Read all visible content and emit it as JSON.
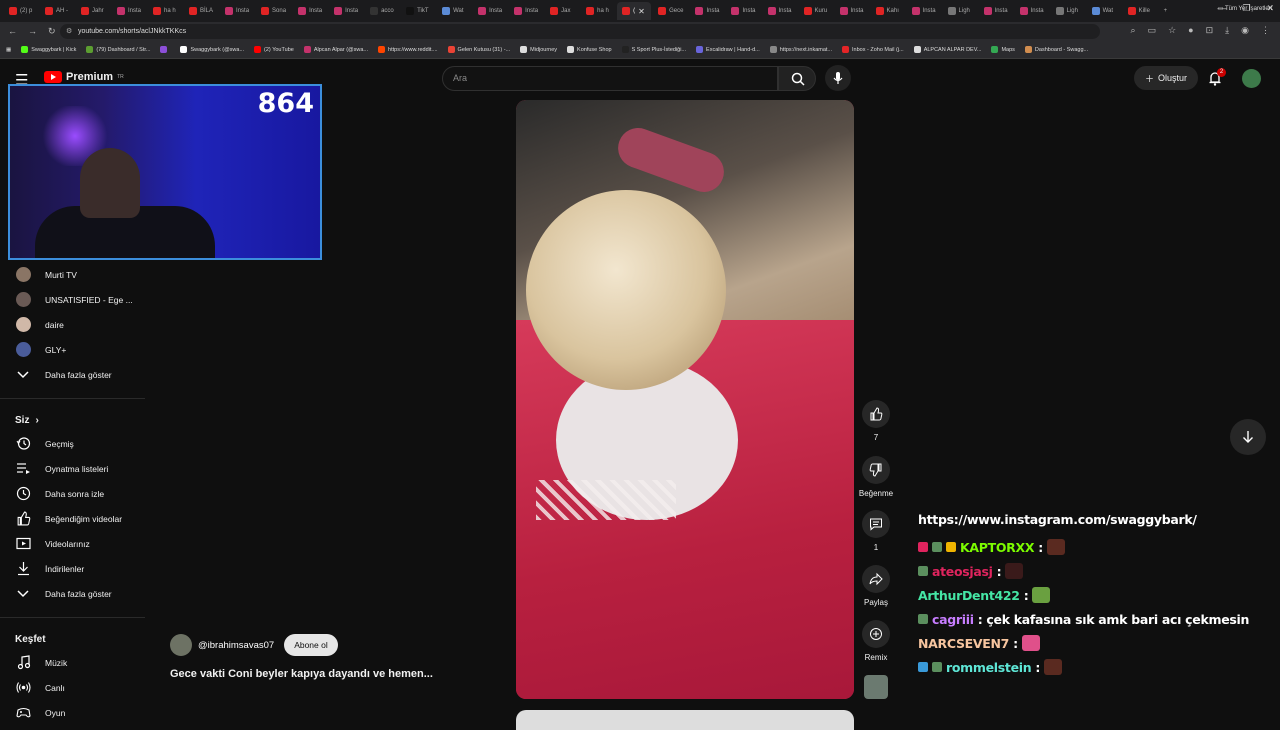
{
  "browser": {
    "tabs": [
      {
        "label": "(2) p",
        "color": "#e02424"
      },
      {
        "label": "AH -",
        "color": "#e02424"
      },
      {
        "label": "Jahr",
        "color": "#e02424"
      },
      {
        "label": "Insta",
        "color": "#c4326b"
      },
      {
        "label": "ha h",
        "color": "#e02424"
      },
      {
        "label": "BİLA",
        "color": "#e02424"
      },
      {
        "label": "Insta",
        "color": "#c4326b"
      },
      {
        "label": "Sona",
        "color": "#e02424"
      },
      {
        "label": "Insta",
        "color": "#c4326b"
      },
      {
        "label": "Insta",
        "color": "#c4326b"
      },
      {
        "label": "acco",
        "color": "#333333"
      },
      {
        "label": "TikT",
        "color": "#111111"
      },
      {
        "label": "Wat",
        "color": "#5b8bd6"
      },
      {
        "label": "Insta",
        "color": "#c4326b"
      },
      {
        "label": "Insta",
        "color": "#c4326b"
      },
      {
        "label": "Jax",
        "color": "#e02424"
      },
      {
        "label": "ha h",
        "color": "#e02424"
      },
      {
        "label": "(",
        "color": "#e02424"
      },
      {
        "label": "Gece",
        "color": "#e02424"
      },
      {
        "label": "Insta",
        "color": "#c4326b"
      },
      {
        "label": "Insta",
        "color": "#c4326b"
      },
      {
        "label": "Insta",
        "color": "#c4326b"
      },
      {
        "label": "Kuru",
        "color": "#e02424"
      },
      {
        "label": "Insta",
        "color": "#c4326b"
      },
      {
        "label": "Kahı",
        "color": "#e02424"
      },
      {
        "label": "Insta",
        "color": "#c4326b"
      },
      {
        "label": "Ligh",
        "color": "#777777"
      },
      {
        "label": "Insta",
        "color": "#c4326b"
      },
      {
        "label": "Insta",
        "color": "#c4326b"
      },
      {
        "label": "Ligh",
        "color": "#777777"
      },
      {
        "label": "Wat",
        "color": "#5b8bd6"
      },
      {
        "label": "Kille",
        "color": "#e02424"
      }
    ],
    "active_tab_index": 17,
    "new_tab": "+",
    "url": "youtube.com/shorts/aclJNkkTKKcs",
    "bookmarks": [
      {
        "label": "Swaggybark | Kick",
        "color": "#53fc18"
      },
      {
        "label": "(79) Dashboard / Str...",
        "color": "#5c9e31"
      },
      {
        "label": "",
        "color": "#8c4fd8"
      },
      {
        "label": "Swaggybark (@swa...",
        "color": "#ffffff"
      },
      {
        "label": "(2) YouTube",
        "color": "#ff0000"
      },
      {
        "label": "Alpcan Alpar (@swa...",
        "color": "#c4326b"
      },
      {
        "label": "https://www.reddit....",
        "color": "#ff4500"
      },
      {
        "label": "Gelen Kutusu (31) -...",
        "color": "#ea4335"
      },
      {
        "label": "Midjourney",
        "color": "#dddddd"
      },
      {
        "label": "Konfuse Shop",
        "color": "#dddddd"
      },
      {
        "label": "S Sport Plus-İstediği...",
        "color": "#222222"
      },
      {
        "label": "Excalidraw | Hand-d...",
        "color": "#6965db"
      },
      {
        "label": "https://next.inkamat...",
        "color": "#888888"
      },
      {
        "label": "Inbox - Zoho Mail (j...",
        "color": "#e42527"
      },
      {
        "label": "ALPCAN ALPAR DEV...",
        "color": "#dddddd"
      },
      {
        "label": "Maps",
        "color": "#34a853"
      },
      {
        "label": "Dashboard - Swagg...",
        "color": "#d18d4f"
      }
    ],
    "bookmarks_right": "Tüm Yer İşaretleri"
  },
  "youtube": {
    "logo_text": "Premium",
    "logo_region": "TR",
    "search_placeholder": "Ara",
    "create_label": "Oluştur",
    "notifications_count": "2"
  },
  "webcam": {
    "counter": "864"
  },
  "sidebar": {
    "subscriptions": [
      {
        "label": "Murti TV",
        "color": "#8a7565"
      },
      {
        "label": "UNSATISFIED - Ege ...",
        "color": "#6a5a55"
      },
      {
        "label": "daire",
        "color": "#d0b8a8"
      },
      {
        "label": "GLY+",
        "color": "#4a5c9a"
      }
    ],
    "show_more_1": "Daha fazla göster",
    "you_header": "Siz",
    "you_items": [
      {
        "label": "Geçmiş",
        "icon": "history-icon"
      },
      {
        "label": "Oynatma listeleri",
        "icon": "playlists-icon"
      },
      {
        "label": "Daha sonra izle",
        "icon": "watch-later-icon"
      },
      {
        "label": "Beğendiğim videolar",
        "icon": "liked-icon"
      },
      {
        "label": "Videolarınız",
        "icon": "your-videos-icon"
      },
      {
        "label": "İndirilenler",
        "icon": "downloads-icon"
      }
    ],
    "show_more_2": "Daha fazla göster",
    "explore_header": "Keşfet",
    "explore_items": [
      {
        "label": "Müzik",
        "icon": "music-icon"
      },
      {
        "label": "Canlı",
        "icon": "live-icon"
      },
      {
        "label": "Oyun",
        "icon": "gaming-icon"
      }
    ]
  },
  "short": {
    "handle": "@ibrahimsavas07",
    "subscribe_label": "Abone ol",
    "title": "Gece vakti Coni beyler kapıya dayandı ve hemen...",
    "like_count": "7",
    "dislike_label": "Beğenme",
    "comment_count": "1",
    "share_label": "Paylaş",
    "remix_label": "Remix"
  },
  "chat": {
    "link": "https://www.instagram.com/swaggybark/",
    "messages": [
      {
        "user": "KAPTORXX",
        "color": "#7cfc00",
        "text": "",
        "badges": [
          "#e0245e",
          "#5b8f5e",
          "#f0b400"
        ],
        "emote": "#5a2a20"
      },
      {
        "user": "ateosjasj",
        "color": "#e0245e",
        "text": "",
        "badges": [
          "#5b8f5e"
        ],
        "emote": "#3a1a1a"
      },
      {
        "user": "ArthurDent422",
        "color": "#45e6a5",
        "text": "",
        "badges": [],
        "emote": "#6aa040"
      },
      {
        "user": "cagriii",
        "color": "#c77dff",
        "text": "çek kafasına sık amk bari acı çekmesin",
        "badges": [
          "#5b8f5e"
        ],
        "emote": ""
      },
      {
        "user": "NARCSEVEN7",
        "color": "#f7c59f",
        "text": "",
        "badges": [],
        "emote": "#e0508a"
      },
      {
        "user": "rommelstein",
        "color": "#5ee6d6",
        "text": "",
        "badges": [
          "#3a9ad9",
          "#5b8f5e"
        ],
        "emote": "#5a2a20"
      }
    ]
  }
}
